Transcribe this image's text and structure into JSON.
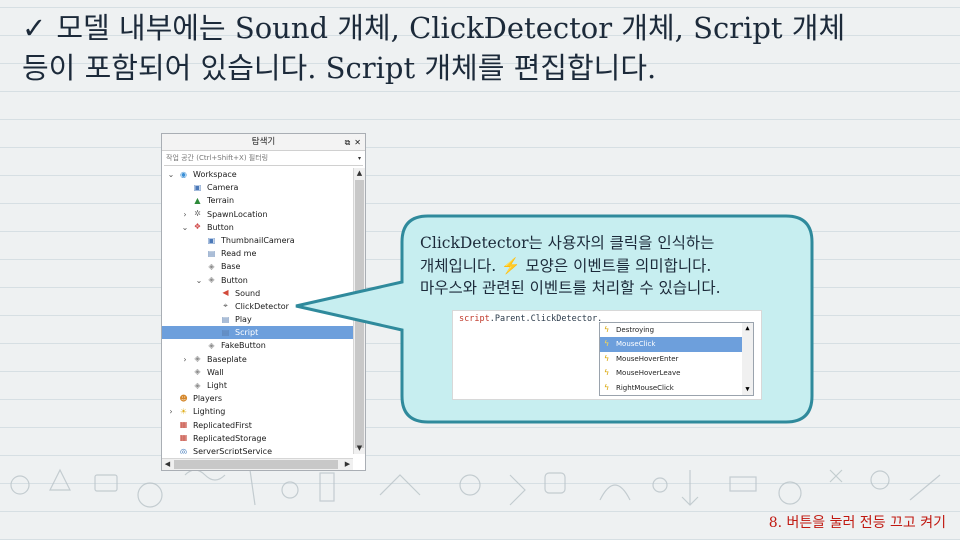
{
  "slide": {
    "title_line1": "모델 내부에는 Sound 개체, ClickDetector 개체, Script 개체",
    "title_line2": "등이 포함되어 있습니다. Script 개체를 편집합니다.",
    "title_icon": "checkmark-icon",
    "footer": "8. 버튼을 눌러 전등 끄고 켜기"
  },
  "explorer": {
    "title": "탐색기",
    "filter_placeholder": "작업 공간 (Ctrl+Shift+X) 필터링",
    "tree": [
      {
        "label": "Workspace",
        "indent": 0,
        "expander": "expanded",
        "icon": "workspace-icon"
      },
      {
        "label": "Camera",
        "indent": 1,
        "expander": "none",
        "icon": "camera-icon"
      },
      {
        "label": "Terrain",
        "indent": 1,
        "expander": "none",
        "icon": "terrain-icon"
      },
      {
        "label": "SpawnLocation",
        "indent": 1,
        "expander": "collapsed",
        "icon": "spawn-icon"
      },
      {
        "label": "Button",
        "indent": 1,
        "expander": "expanded",
        "icon": "model-icon"
      },
      {
        "label": "ThumbnailCamera",
        "indent": 2,
        "expander": "none",
        "icon": "camera-icon"
      },
      {
        "label": "Read me",
        "indent": 2,
        "expander": "none",
        "icon": "script-icon"
      },
      {
        "label": "Base",
        "indent": 2,
        "expander": "none",
        "icon": "part-icon"
      },
      {
        "label": "Button",
        "indent": 2,
        "expander": "expanded",
        "icon": "part-icon"
      },
      {
        "label": "Sound",
        "indent": 3,
        "expander": "none",
        "icon": "sound-icon"
      },
      {
        "label": "ClickDetector",
        "indent": 3,
        "expander": "none",
        "icon": "clickdetector-icon"
      },
      {
        "label": "Play",
        "indent": 3,
        "expander": "none",
        "icon": "script-icon"
      },
      {
        "label": "Script",
        "indent": 3,
        "expander": "none",
        "icon": "script-icon",
        "selected": true
      },
      {
        "label": "FakeButton",
        "indent": 2,
        "expander": "none",
        "icon": "part-icon"
      },
      {
        "label": "Baseplate",
        "indent": 1,
        "expander": "collapsed",
        "icon": "part-icon"
      },
      {
        "label": "Wall",
        "indent": 1,
        "expander": "none",
        "icon": "part-icon"
      },
      {
        "label": "Light",
        "indent": 1,
        "expander": "none",
        "icon": "part-icon"
      },
      {
        "label": "Players",
        "indent": 0,
        "expander": "none",
        "icon": "players-icon"
      },
      {
        "label": "Lighting",
        "indent": 0,
        "expander": "collapsed",
        "icon": "lighting-icon"
      },
      {
        "label": "ReplicatedFirst",
        "indent": 0,
        "expander": "none",
        "icon": "replicated-icon"
      },
      {
        "label": "ReplicatedStorage",
        "indent": 0,
        "expander": "none",
        "icon": "replicated-icon"
      },
      {
        "label": "ServerScriptService",
        "indent": 0,
        "expander": "none",
        "icon": "server-icon"
      }
    ]
  },
  "callout": {
    "line1": "ClickDetector는 사용자의 클릭을 인식하는",
    "line2": "개체입니다. ⚡ 모양은 이벤트를 의미합니다.",
    "line3": "마우스와 관련된 이벤트를 처리할 수 있습니다."
  },
  "autocomplete": {
    "code_keyword": "script",
    "code_rest": ".Parent.ClickDetector.",
    "items": [
      {
        "label": "Destroying",
        "selected": false
      },
      {
        "label": "MouseClick",
        "selected": true
      },
      {
        "label": "MouseHoverEnter",
        "selected": false
      },
      {
        "label": "MouseHoverLeave",
        "selected": false
      },
      {
        "label": "RightMouseClick",
        "selected": false
      }
    ]
  },
  "colors": {
    "selection": "#6d9fdc",
    "callout_fill": "#c7eef0",
    "callout_border": "#2f8a9c",
    "footer": "#c0170f"
  }
}
